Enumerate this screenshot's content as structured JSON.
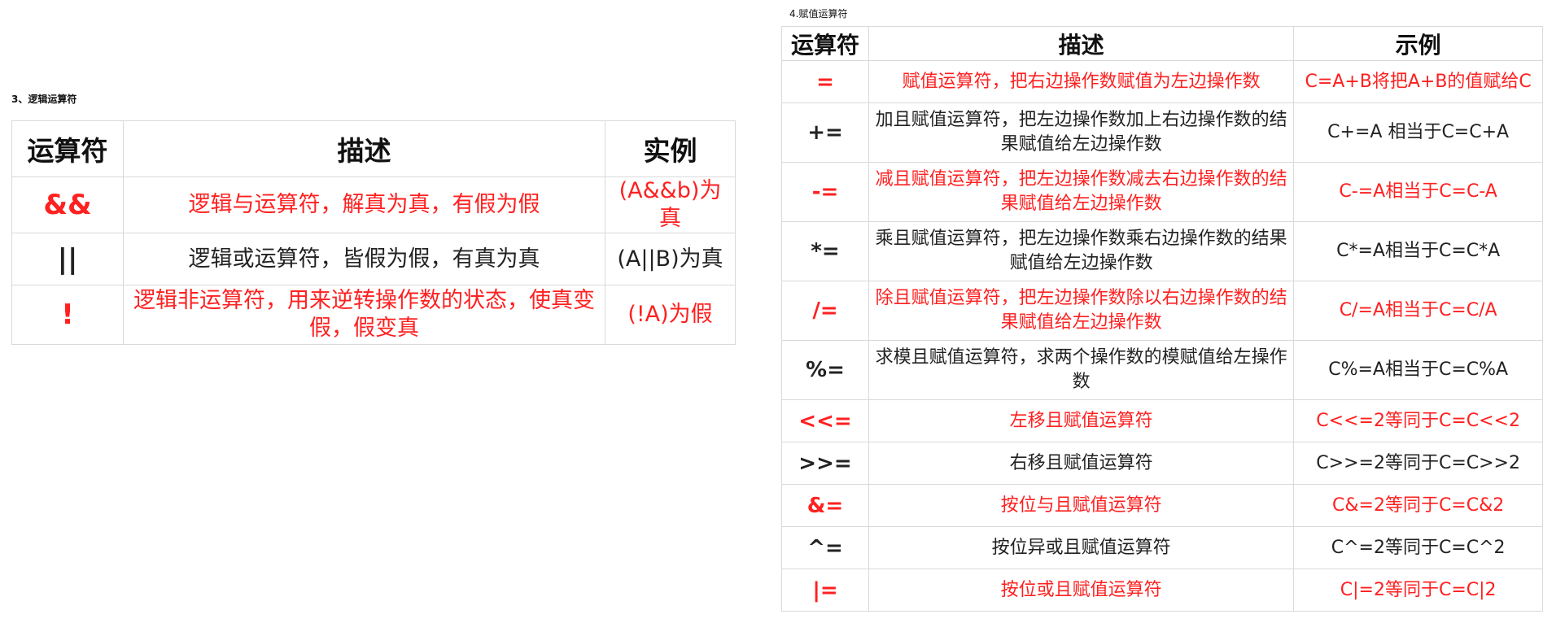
{
  "logic_section": {
    "caption": "3、逻辑运算符",
    "headers": [
      "运算符",
      "描述",
      "实例"
    ],
    "rows": [
      {
        "op": "&&",
        "desc": "逻辑与运算符，解真为真，有假为假",
        "example": "(A&&b)为真",
        "color": "#ff2020"
      },
      {
        "op": "||",
        "desc": "逻辑或运算符，皆假为假，有真为真",
        "example": "(A||B)为真",
        "color": "#222222"
      },
      {
        "op": "!",
        "desc": "逻辑非运算符，用来逆转操作数的状态，使真变假，假变真",
        "example": "(!A)为假",
        "color": "#ff2020"
      }
    ]
  },
  "assign_section": {
    "caption": "4.赋值运算符",
    "headers": [
      "运算符",
      "描述",
      "示例"
    ],
    "rows": [
      {
        "op": "=",
        "desc": "赋值运算符，把右边操作数赋值为左边操作数",
        "example": "C=A+B将把A+B的值赋给C",
        "color": "#ff2020"
      },
      {
        "op": "+=",
        "desc": "加且赋值运算符，把左边操作数加上右边操作数的结果赋值给左边操作数",
        "example": "C+=A 相当于C=C+A",
        "color": "#222222"
      },
      {
        "op": "-=",
        "desc": "减且赋值运算符，把左边操作数减去右边操作数的结果赋值给左边操作数",
        "example": "C-=A相当于C=C-A",
        "color": "#ff2020"
      },
      {
        "op": "*=",
        "desc": "乘且赋值运算符，把左边操作数乘右边操作数的结果赋值给左边操作数",
        "example": "C*=A相当于C=C*A",
        "color": "#222222"
      },
      {
        "op": "/=",
        "desc": "除且赋值运算符，把左边操作数除以右边操作数的结果赋值给左边操作数",
        "example": "C/=A相当于C=C/A",
        "color": "#ff2020"
      },
      {
        "op": "%=",
        "desc": "求模且赋值运算符，求两个操作数的模赋值给左操作数",
        "example": "C%=A相当于C=C%A",
        "color": "#222222"
      },
      {
        "op": "<<=",
        "desc": "左移且赋值运算符",
        "example": "C<<=2等同于C=C<<2",
        "color": "#ff2020"
      },
      {
        "op": ">>=",
        "desc": "右移且赋值运算符",
        "example": "C>>=2等同于C=C>>2",
        "color": "#222222"
      },
      {
        "op": "&=",
        "desc": "按位与且赋值运算符",
        "example": "C&=2等同于C=C&2",
        "color": "#ff2020"
      },
      {
        "op": "^=",
        "desc": "按位异或且赋值运算符",
        "example": "C^=2等同于C=C^2",
        "color": "#222222"
      },
      {
        "op": "|=",
        "desc": "按位或且赋值运算符",
        "example": "C|=2等同于C=C|2",
        "color": "#ff2020"
      }
    ]
  }
}
